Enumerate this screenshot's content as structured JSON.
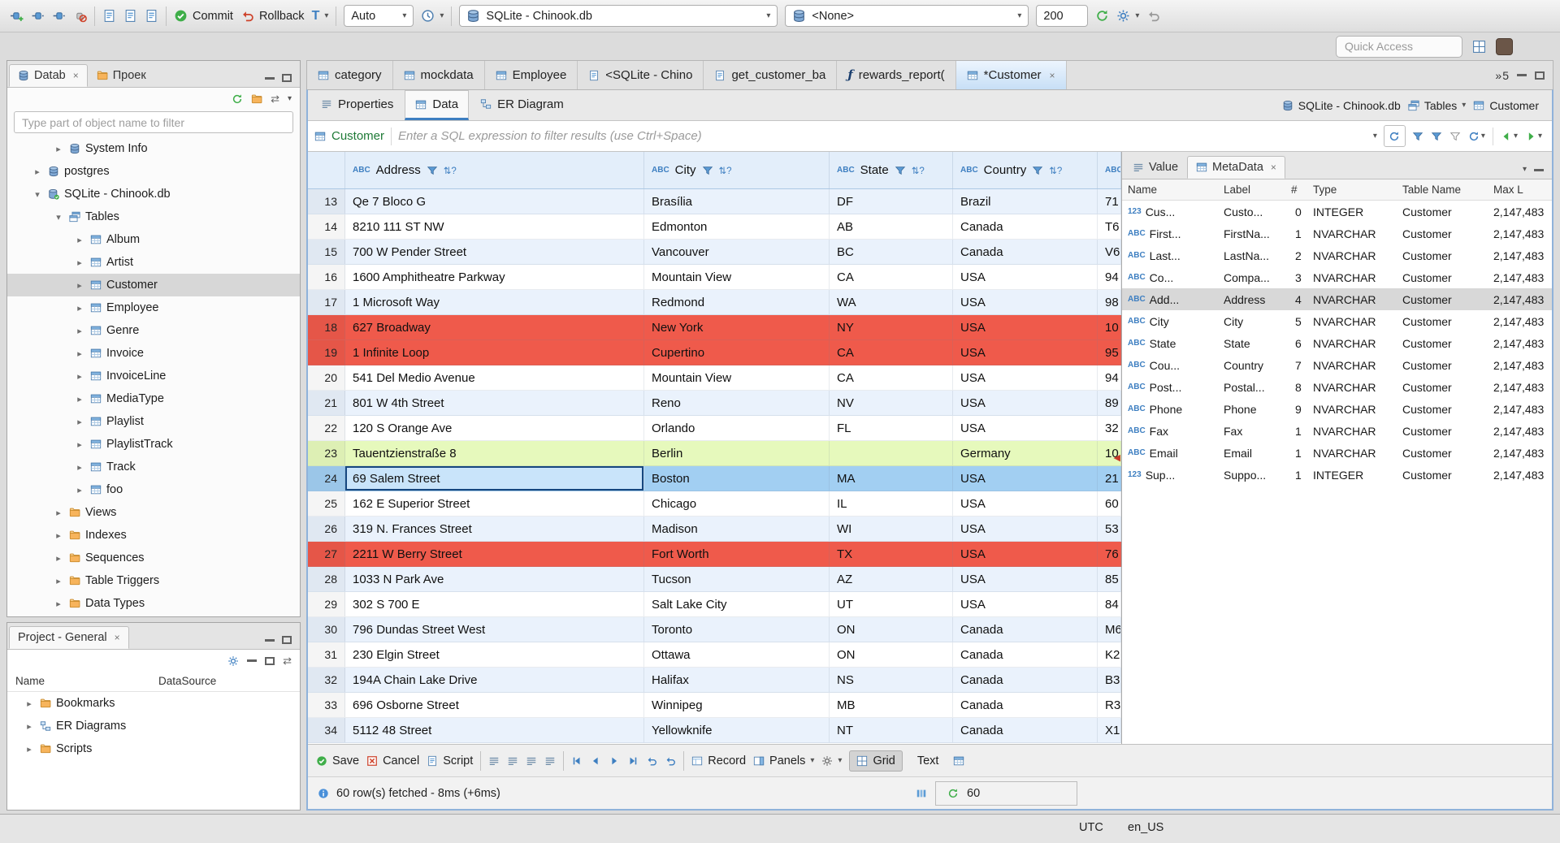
{
  "toolbar": {
    "commit_label": "Commit",
    "rollback_label": "Rollback",
    "txn_mode": "T",
    "auto_label": "Auto",
    "database_combo": "SQLite - Chinook.db",
    "schema_combo": "<None>",
    "resultset_size": "200",
    "quick_access_placeholder": "Quick Access"
  },
  "left_panel": {
    "tabs": [
      {
        "label": "Datab",
        "active": true,
        "closable": true
      },
      {
        "label": "Проек",
        "active": false,
        "closable": false
      }
    ],
    "filter_placeholder": "Type part of object name to filter",
    "tree": [
      {
        "label": "System Info",
        "depth": 2,
        "expanded": false,
        "leaf": false,
        "icon": "db"
      },
      {
        "label": "postgres",
        "depth": 1,
        "expanded": false,
        "leaf": false,
        "icon": "db"
      },
      {
        "label": "SQLite - Chinook.db",
        "depth": 1,
        "expanded": true,
        "leaf": false,
        "icon": "db-check"
      },
      {
        "label": "Tables",
        "depth": 2,
        "expanded": true,
        "leaf": false,
        "icon": "tables"
      },
      {
        "label": "Album",
        "depth": 3,
        "expanded": false,
        "leaf": false,
        "icon": "table"
      },
      {
        "label": "Artist",
        "depth": 3,
        "expanded": false,
        "leaf": false,
        "icon": "table"
      },
      {
        "label": "Customer",
        "depth": 3,
        "expanded": false,
        "leaf": false,
        "icon": "table",
        "selected": true
      },
      {
        "label": "Employee",
        "depth": 3,
        "expanded": false,
        "leaf": false,
        "icon": "table"
      },
      {
        "label": "Genre",
        "depth": 3,
        "expanded": false,
        "leaf": false,
        "icon": "table"
      },
      {
        "label": "Invoice",
        "depth": 3,
        "expanded": false,
        "leaf": false,
        "icon": "table"
      },
      {
        "label": "InvoiceLine",
        "depth": 3,
        "expanded": false,
        "leaf": false,
        "icon": "table"
      },
      {
        "label": "MediaType",
        "depth": 3,
        "expanded": false,
        "leaf": false,
        "icon": "table"
      },
      {
        "label": "Playlist",
        "depth": 3,
        "expanded": false,
        "leaf": false,
        "icon": "table"
      },
      {
        "label": "PlaylistTrack",
        "depth": 3,
        "expanded": false,
        "leaf": false,
        "icon": "table"
      },
      {
        "label": "Track",
        "depth": 3,
        "expanded": false,
        "leaf": false,
        "icon": "table"
      },
      {
        "label": "foo",
        "depth": 3,
        "expanded": false,
        "leaf": false,
        "icon": "table"
      },
      {
        "label": "Views",
        "depth": 2,
        "expanded": false,
        "leaf": false,
        "icon": "folder"
      },
      {
        "label": "Indexes",
        "depth": 2,
        "expanded": false,
        "leaf": false,
        "icon": "folder"
      },
      {
        "label": "Sequences",
        "depth": 2,
        "expanded": false,
        "leaf": false,
        "icon": "folder"
      },
      {
        "label": "Table Triggers",
        "depth": 2,
        "expanded": false,
        "leaf": false,
        "icon": "folder"
      },
      {
        "label": "Data Types",
        "depth": 2,
        "expanded": false,
        "leaf": false,
        "icon": "folder"
      }
    ]
  },
  "projects_panel": {
    "tab_label": "Project - General",
    "columns": [
      "Name",
      "DataSource"
    ],
    "items": [
      {
        "label": "Bookmarks",
        "icon": "folder"
      },
      {
        "label": "ER Diagrams",
        "icon": "diagram"
      },
      {
        "label": "Scripts",
        "icon": "folder"
      }
    ]
  },
  "editor": {
    "tabs": [
      {
        "label": "category",
        "icon": "table",
        "active": false,
        "closable": false
      },
      {
        "label": "mockdata",
        "icon": "table",
        "active": false,
        "closable": false
      },
      {
        "label": "Employee",
        "icon": "table",
        "active": false,
        "closable": false
      },
      {
        "label": "<SQLite - Chino",
        "icon": "sql",
        "active": false,
        "closable": false
      },
      {
        "label": "get_customer_ba",
        "icon": "sql",
        "active": false,
        "closable": false
      },
      {
        "label": "rewards_report(",
        "icon": "function",
        "active": false,
        "closable": false
      },
      {
        "label": "*Customer",
        "icon": "table",
        "active": true,
        "closable": true
      }
    ],
    "hidden_tabs_count": "5",
    "breadcrumb": {
      "database": "SQLite - Chinook.db",
      "container": "Tables",
      "table": "Customer"
    },
    "subtabs": [
      {
        "label": "Properties",
        "icon": "props",
        "active": false
      },
      {
        "label": "Data",
        "icon": "table",
        "active": true
      },
      {
        "label": "ER Diagram",
        "icon": "diagram",
        "active": false
      }
    ],
    "filter_bar": {
      "table": "Customer",
      "placeholder": "Enter a SQL expression to filter results (use Ctrl+Space)"
    }
  },
  "grid": {
    "columns": [
      {
        "badge": "ABC",
        "label": "Address"
      },
      {
        "badge": "ABC",
        "label": "City"
      },
      {
        "badge": "ABC",
        "label": "State"
      },
      {
        "badge": "ABC",
        "label": "Country"
      },
      {
        "badge": "ABC",
        "label": ""
      }
    ],
    "rows": [
      {
        "num": "13",
        "cells": [
          "Qe 7 Bloco G",
          "Brasília",
          "DF",
          "Brazil",
          "71"
        ],
        "style": "alt"
      },
      {
        "num": "14",
        "cells": [
          "8210 111 ST NW",
          "Edmonton",
          "AB",
          "Canada",
          "T6"
        ],
        "style": "plain"
      },
      {
        "num": "15",
        "cells": [
          "700 W Pender Street",
          "Vancouver",
          "BC",
          "Canada",
          "V6"
        ],
        "style": "alt"
      },
      {
        "num": "16",
        "cells": [
          "1600 Amphitheatre Parkway",
          "Mountain View",
          "CA",
          "USA",
          "94"
        ],
        "style": "plain"
      },
      {
        "num": "17",
        "cells": [
          "1 Microsoft Way",
          "Redmond",
          "WA",
          "USA",
          "98"
        ],
        "style": "alt"
      },
      {
        "num": "18",
        "cells": [
          "627 Broadway",
          "New York",
          "NY",
          "USA",
          "10"
        ],
        "style": "red"
      },
      {
        "num": "19",
        "cells": [
          "1 Infinite Loop",
          "Cupertino",
          "CA",
          "USA",
          "95"
        ],
        "style": "red"
      },
      {
        "num": "20",
        "cells": [
          "541 Del Medio Avenue",
          "Mountain View",
          "CA",
          "USA",
          "94"
        ],
        "style": "plain"
      },
      {
        "num": "21",
        "cells": [
          "801 W 4th Street",
          "Reno",
          "NV",
          "USA",
          "89"
        ],
        "style": "alt"
      },
      {
        "num": "22",
        "cells": [
          "120 S Orange Ave",
          "Orlando",
          "FL",
          "USA",
          "32"
        ],
        "style": "plain"
      },
      {
        "num": "23",
        "cells": [
          "Tauentzienstraße 8",
          "Berlin",
          "",
          "Germany",
          "10"
        ],
        "style": "green"
      },
      {
        "num": "24",
        "cells": [
          "69 Salem Street",
          "Boston",
          "MA",
          "USA",
          "21"
        ],
        "style": "selected"
      },
      {
        "num": "25",
        "cells": [
          "162 E Superior Street",
          "Chicago",
          "IL",
          "USA",
          "60"
        ],
        "style": "plain"
      },
      {
        "num": "26",
        "cells": [
          "319 N. Frances Street",
          "Madison",
          "WI",
          "USA",
          "53"
        ],
        "style": "alt"
      },
      {
        "num": "27",
        "cells": [
          "2211 W Berry Street",
          "Fort Worth",
          "TX",
          "USA",
          "76"
        ],
        "style": "red"
      },
      {
        "num": "28",
        "cells": [
          "1033 N Park Ave",
          "Tucson",
          "AZ",
          "USA",
          "85"
        ],
        "style": "alt"
      },
      {
        "num": "29",
        "cells": [
          "302 S 700 E",
          "Salt Lake City",
          "UT",
          "USA",
          "84"
        ],
        "style": "plain"
      },
      {
        "num": "30",
        "cells": [
          "796 Dundas Street West",
          "Toronto",
          "ON",
          "Canada",
          "M6"
        ],
        "style": "alt"
      },
      {
        "num": "31",
        "cells": [
          "230 Elgin Street",
          "Ottawa",
          "ON",
          "Canada",
          "K2"
        ],
        "style": "plain"
      },
      {
        "num": "32",
        "cells": [
          "194A Chain Lake Drive",
          "Halifax",
          "NS",
          "Canada",
          "B3"
        ],
        "style": "alt"
      },
      {
        "num": "33",
        "cells": [
          "696 Osborne Street",
          "Winnipeg",
          "MB",
          "Canada",
          "R3"
        ],
        "style": "plain"
      },
      {
        "num": "34",
        "cells": [
          "5112 48 Street",
          "Yellowknife",
          "NT",
          "Canada",
          "X1"
        ],
        "style": "alt"
      }
    ]
  },
  "side_panel": {
    "tabs": [
      {
        "label": "Value",
        "active": false,
        "closable": false
      },
      {
        "label": "MetaData",
        "active": true,
        "closable": true
      }
    ],
    "columns": [
      "Name",
      "Label",
      "#",
      "Type",
      "Table Name",
      "Max L"
    ],
    "rows": [
      {
        "badge": "123",
        "name": "Cus...",
        "label": "Custo...",
        "ord": "0",
        "type": "INTEGER",
        "table": "Customer",
        "maxlen": "2,147,483",
        "selected": false
      },
      {
        "badge": "ABC",
        "name": "First...",
        "label": "FirstNa...",
        "ord": "1",
        "type": "NVARCHAR",
        "table": "Customer",
        "maxlen": "2,147,483",
        "selected": false
      },
      {
        "badge": "ABC",
        "name": "Last...",
        "label": "LastNa...",
        "ord": "2",
        "type": "NVARCHAR",
        "table": "Customer",
        "maxlen": "2,147,483",
        "selected": false
      },
      {
        "badge": "ABC",
        "name": "Co...",
        "label": "Compa...",
        "ord": "3",
        "type": "NVARCHAR",
        "table": "Customer",
        "maxlen": "2,147,483",
        "selected": false
      },
      {
        "badge": "ABC",
        "name": "Add...",
        "label": "Address",
        "ord": "4",
        "type": "NVARCHAR",
        "table": "Customer",
        "maxlen": "2,147,483",
        "selected": true
      },
      {
        "badge": "ABC",
        "name": "City",
        "label": "City",
        "ord": "5",
        "type": "NVARCHAR",
        "table": "Customer",
        "maxlen": "2,147,483",
        "selected": false
      },
      {
        "badge": "ABC",
        "name": "State",
        "label": "State",
        "ord": "6",
        "type": "NVARCHAR",
        "table": "Customer",
        "maxlen": "2,147,483",
        "selected": false
      },
      {
        "badge": "ABC",
        "name": "Cou...",
        "label": "Country",
        "ord": "7",
        "type": "NVARCHAR",
        "table": "Customer",
        "maxlen": "2,147,483",
        "selected": false
      },
      {
        "badge": "ABC",
        "name": "Post...",
        "label": "Postal...",
        "ord": "8",
        "type": "NVARCHAR",
        "table": "Customer",
        "maxlen": "2,147,483",
        "selected": false
      },
      {
        "badge": "ABC",
        "name": "Phone",
        "label": "Phone",
        "ord": "9",
        "type": "NVARCHAR",
        "table": "Customer",
        "maxlen": "2,147,483",
        "selected": false
      },
      {
        "badge": "ABC",
        "name": "Fax",
        "label": "Fax",
        "ord": "1",
        "type": "NVARCHAR",
        "table": "Customer",
        "maxlen": "2,147,483",
        "selected": false
      },
      {
        "badge": "ABC",
        "name": "Email",
        "label": "Email",
        "ord": "1",
        "type": "NVARCHAR",
        "table": "Customer",
        "maxlen": "2,147,483",
        "selected": false
      },
      {
        "badge": "123",
        "name": "Sup...",
        "label": "Suppo...",
        "ord": "1",
        "type": "INTEGER",
        "table": "Customer",
        "maxlen": "2,147,483",
        "selected": false
      }
    ]
  },
  "result_toolbar": {
    "save": "Save",
    "cancel": "Cancel",
    "script": "Script",
    "record": "Record",
    "panels": "Panels",
    "grid": "Grid",
    "text": "Text"
  },
  "status": {
    "message": "60 row(s) fetched - 8ms (+6ms)",
    "fetch_size": "60"
  },
  "window_status": {
    "timezone": "UTC",
    "locale": "en_US"
  }
}
